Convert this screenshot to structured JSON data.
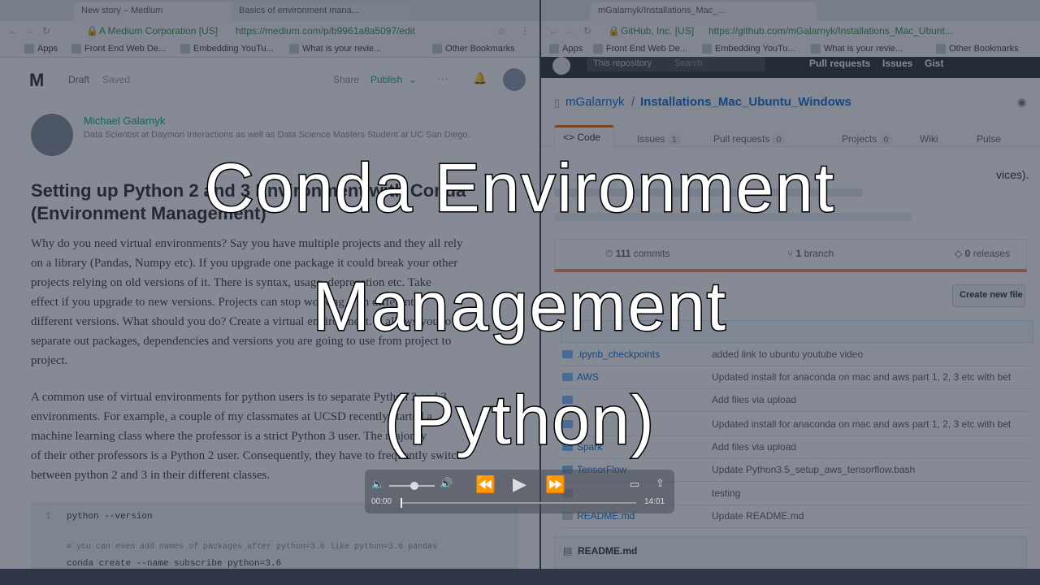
{
  "left": {
    "tab_title": "New story – Medium",
    "tab2_title": "Basics of environment mana...",
    "site_name": "A Medium Corporation [US]",
    "url": "https://medium.com/p/b9961a8a5097/edit",
    "bookmarks": [
      "Apps",
      "Front End Web De...",
      "Embedding YouTu...",
      "What is your revie..."
    ],
    "other_bookmarks": "Other Bookmarks",
    "status_draft": "Draft",
    "status_saved": "Saved",
    "share_label": "Share",
    "publish_label": "Publish",
    "more_label": "···",
    "author": "Michael Galarnyk",
    "author_bio": "Data Scientist at Daymon Interactions as well as Data Science Masters Student at UC San Diego.",
    "heading_line1": "Setting up Python 2 and 3 Environment with Conda",
    "heading_line2": "(Environment Management)",
    "paragraph1": [
      "Why do you need virtual environments? Say you have multiple projects and they all rely",
      "on a library (Pandas, Numpy etc). If you upgrade one package it could break your other",
      "projects relying on old versions of it. There is syntax, usage, deprecation etc. Take",
      "effect if you upgrade to new versions. Projects can stop working with different",
      "different versions. What should you do? Create a virtual environment. It allows you to",
      "separate out packages, dependencies and versions you are going to use from project to",
      "project."
    ],
    "paragraph2": [
      "A common use of virtual environments for python users is to separate Python 2 and 3",
      "environments. For example, a couple of my classmates at UCSD recently started a",
      "machine learning class where the professor is a strict Python 3 user. The majority",
      "of their other professors is a Python 2 user. Consequently, they have to frequently switch",
      "between python 2 and 3 in their different classes."
    ],
    "code_line1": "python --version",
    "code_line2": "# you can even add names of packages after python=3.6 like python=3.6 pandas",
    "code_line3": "conda create --name subscribe python=3.6"
  },
  "right": {
    "tab_title": "mGalarnyk/Installations_Mac_...",
    "site_name": "GitHub, Inc. [US]",
    "url": "https://github.com/mGalarnyk/Installations_Mac_Ubunt...",
    "bookmarks": [
      "Apps",
      "Front End Web De...",
      "Embedding YouTu...",
      "What is your revie..."
    ],
    "other_bookmarks": "Other Bookmarks",
    "nav_repo": "This repository",
    "nav_search": "Search",
    "nav_pull": "Pull requests",
    "nav_issues": "Issues",
    "nav_gist": "Gist",
    "owner": "mGalarnyk",
    "separator": "/",
    "repo": "Installations_Mac_Ubuntu_Windows",
    "tabs": [
      {
        "label": "<> Code",
        "count": ""
      },
      {
        "label": "Issues",
        "count": "1"
      },
      {
        "label": "Pull requests",
        "count": "0"
      },
      {
        "label": "Projects",
        "count": "0"
      },
      {
        "label": "Wiki",
        "count": ""
      },
      {
        "label": "Pulse",
        "count": ""
      }
    ],
    "desc_tail": "vices).",
    "commits_count": "111",
    "commits_label": "commits",
    "branch_count": "1",
    "branch_label": "branch",
    "releases_count": "0",
    "releases_label": "releases",
    "create_new_file": "Create new file",
    "files": [
      {
        "name": ".ipynb_checkpoints",
        "message": "added link to ubuntu youtube video"
      },
      {
        "name": "AWS",
        "message": "Updated install for anaconda on mac and aws part 1, 2, 3 etc with bet"
      },
      {
        "name": "",
        "message": "Add files via upload"
      },
      {
        "name": "",
        "message": "Updated install for anaconda on mac and aws part 1, 2, 3 etc with bet"
      },
      {
        "name": "Spark",
        "message": "Add files via upload"
      },
      {
        "name": "TensorFlow",
        "message": "Update Python3.5_setup_aws_tensorflow.bash"
      },
      {
        "name": "",
        "message": "testing"
      },
      {
        "name": "README.md",
        "message": "Update README.md"
      }
    ],
    "readme_header": "README.md"
  },
  "player": {
    "time_current": "00:00",
    "time_total": "14:01",
    "progress": 0.0,
    "volume": 0.55
  },
  "overlay": {
    "line1": "Conda Environment",
    "line2": "Management",
    "line3": "(Python)"
  }
}
